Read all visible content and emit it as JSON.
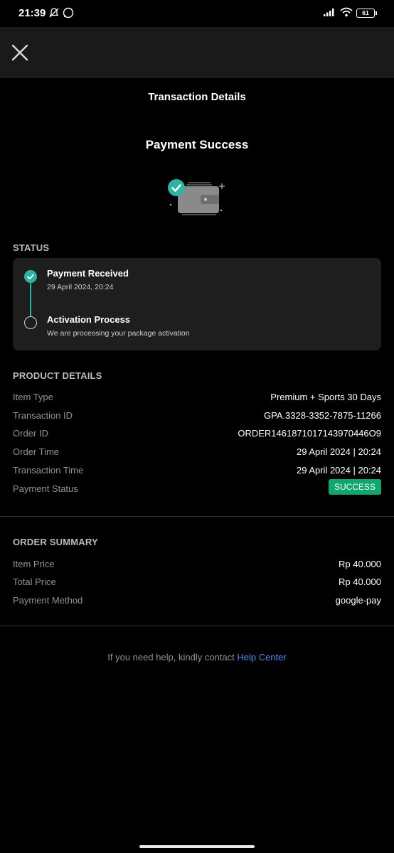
{
  "status_bar": {
    "time": "21:39",
    "battery": "61"
  },
  "header": {
    "title": "Transaction Details"
  },
  "hero": {
    "title": "Payment Success"
  },
  "status": {
    "label": "STATUS",
    "steps": [
      {
        "title": "Payment Received",
        "subtitle": "29 April 2024, 20:24",
        "done": true
      },
      {
        "title": "Activation Process",
        "subtitle": "We are processing your package activation",
        "done": false
      }
    ]
  },
  "product": {
    "label": "PRODUCT DETAILS",
    "rows": [
      {
        "key": "Item Type",
        "value": "Premium + Sports 30 Days"
      },
      {
        "key": "Transaction ID",
        "value": "GPA.3328-3352-7875-11266"
      },
      {
        "key": "Order ID",
        "value": "ORDER1461871017143970446O9"
      },
      {
        "key": "Order Time",
        "value": "29 April 2024 | 20:24"
      },
      {
        "key": "Transaction Time",
        "value": "29 April 2024 | 20:24"
      },
      {
        "key": "Payment Status",
        "value": "SUCCESS"
      }
    ]
  },
  "summary": {
    "label": "ORDER SUMMARY",
    "rows": [
      {
        "key": "Item Price",
        "value": "Rp 40.000"
      },
      {
        "key": "Total Price",
        "value": "Rp 40.000"
      },
      {
        "key": "Payment Method",
        "value": "google-pay"
      }
    ]
  },
  "help": {
    "text": "If you need help, kindly contact ",
    "link": "Help Center"
  },
  "colors": {
    "accent": "#2bb3a3",
    "success_badge": "#10a66e",
    "link": "#4d8ff0"
  }
}
